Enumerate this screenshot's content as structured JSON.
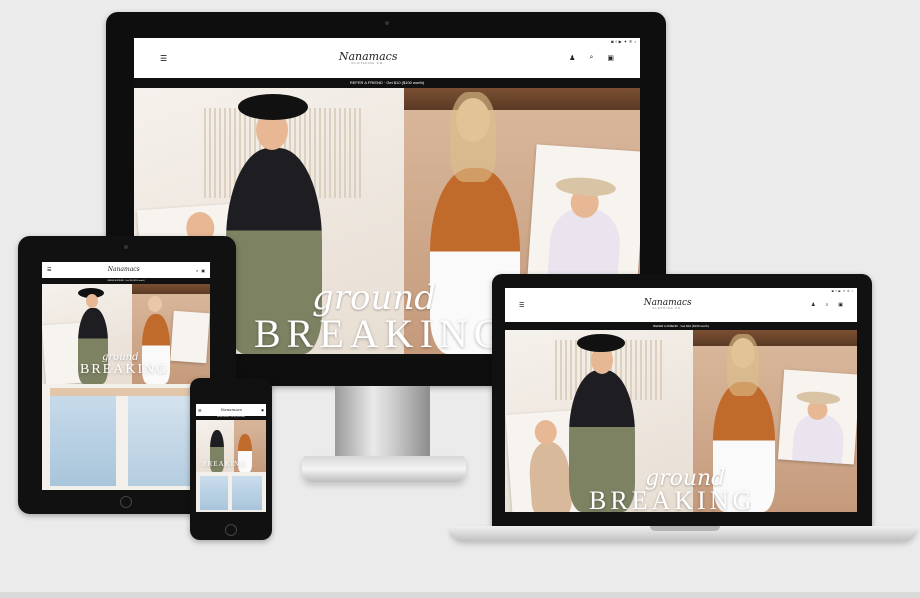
{
  "brand": {
    "logo_script": "Nanamacs",
    "logo_sub": "CLOTHING CO."
  },
  "promo_bar": {
    "text": "REFER A FRIEND · Get $10 ($100 worth)"
  },
  "hero": {
    "script": "ground",
    "headline": "BREAKING"
  },
  "icons": {
    "menu": "hamburger-menu-icon",
    "account": "user-icon",
    "search": "search-icon",
    "cart": "bag-icon",
    "social": [
      "instagram-icon",
      "facebook-icon",
      "youtube-icon",
      "twitter-icon",
      "pinterest-icon",
      "tiktok-icon"
    ]
  },
  "colors": {
    "bezel": "#111111",
    "promo_bg": "#111111",
    "background": "#ebebeb",
    "accent_rust": "#c06a2b"
  }
}
